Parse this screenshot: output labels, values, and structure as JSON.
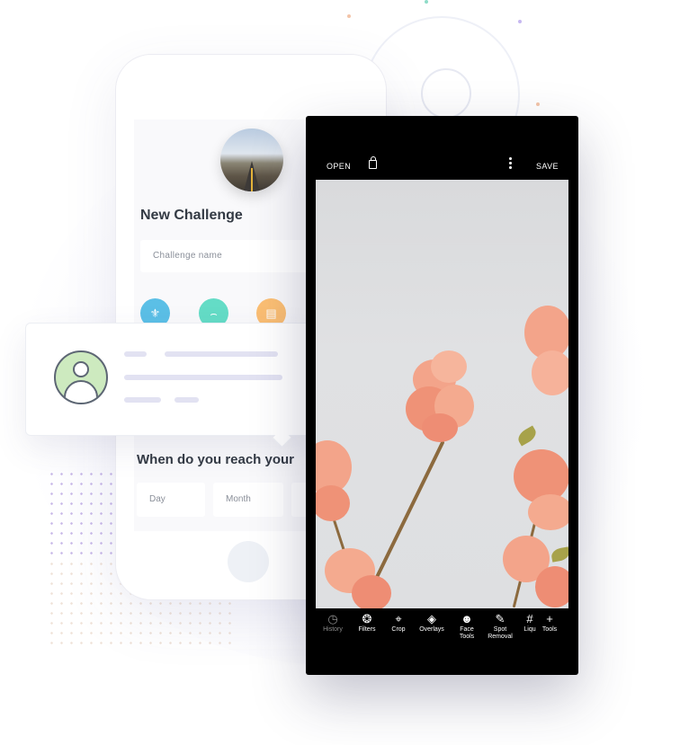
{
  "challenge_form": {
    "title": "New Challenge",
    "name_placeholder": "Challenge name",
    "reach_title": "When do you reach your",
    "day_label": "Day",
    "month_label": "Month"
  },
  "editor": {
    "open_label": "OPEN",
    "save_label": "SAVE",
    "tools": [
      {
        "label": "History",
        "icon": "history-icon"
      },
      {
        "label": "Filters",
        "icon": "filters-icon"
      },
      {
        "label": "Crop",
        "icon": "crop-icon"
      },
      {
        "label": "Overlays",
        "icon": "layers-icon"
      },
      {
        "label": "Face Tools",
        "icon": "face-icon"
      },
      {
        "label": "Spot Removal",
        "icon": "bandage-icon"
      },
      {
        "label": "Liqu",
        "icon": "grid-icon"
      },
      {
        "label": "Tools",
        "icon": "plus-icon"
      }
    ]
  },
  "colors": {
    "category_blue": "#5bbfe6",
    "category_teal": "#64dcc6",
    "category_orange": "#fcbf73",
    "avatar_bg": "#cdeabf"
  }
}
